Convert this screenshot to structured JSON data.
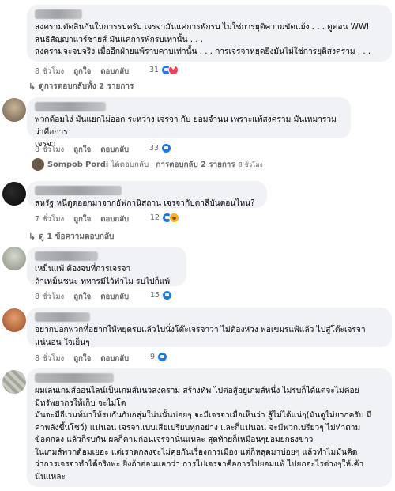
{
  "colors": {
    "bubble": "#f0f2f5",
    "meta_text": "#65676b",
    "like": "#1877f2",
    "love": "#f33e58",
    "haha": "#f7b125"
  },
  "actions": {
    "like": "ถูกใจ",
    "reply": "ตอบกลับ"
  },
  "comments": [
    {
      "text": "สงครามตัดสินกันในการรบครับ เจรจามันแค่การพักรบ ไม่ใช่การยุติความขัดแย้ง . . . ดูตอน WWI\nสนธิสัญญาแวร์ซายส์ มันแค่การพักรบเท่านั้น . . .\nสงครามจะจบจริง เมื่ออีกฝ่ายแพ้ราบคาบเท่านั้น . . . การเจรจาหยุดยิงมันไม่ใช่การยุติสงคราม . . .",
      "time": "8 ชั่วโมง",
      "reactions": "31",
      "reaction_icons": [
        "like-icon",
        "love-icon"
      ],
      "replies_link": "ดูการตอบกลับทั้ง 2 รายการ"
    },
    {
      "text": "พวกด้อมโง่ มันแยกไม่ออก ระหว่าง เจรจา กับ ยอมจำนน เพราะแพ้สงคราม มันเหมารวมว่าคือการ\nเจรจา",
      "time": "8 ชั่วโมง",
      "reactions": "33",
      "reaction_icons": [
        "like-icon"
      ],
      "reply_preview": {
        "name": "Sompob Pordi",
        "action": "ได้ตอบกลับ ·",
        "count": "การตอบกลับ 2 รายการ",
        "time": "8 ชั่วโมง"
      }
    },
    {
      "text": "สหรัฐ หนีตูดออกมาจากอัฟกานิสถาน เจรจากับตาลีบันตอนไหน?",
      "time": "7 ชั่วโมง",
      "reactions": "12",
      "reaction_icons": [
        "like-icon",
        "haha-icon"
      ],
      "replies_link": "ดู 1 ข้อความตอบกลับ"
    },
    {
      "text": "เหม็นแพ้ ต้องจบที่การเจรจา\nถ้าเหม็นชนะ ทหารมีไว้ทำไม รบไปก็แพ้",
      "time": "8 ชั่วโมง",
      "reactions": "15",
      "reaction_icons": [
        "like-icon"
      ]
    },
    {
      "text": "อยากบอกพวกที่อยากให้หยุดรบแล้วไปนั่งโต๊ะเจรจาว่า ไม่ต้องห่วง พอเขมรแพ้แล้ว ไปสู่โต๊ะเจรจา\nแน่นอน ใจเย็นๆ",
      "time": "8 ชั่วโมง",
      "reactions": "9",
      "reaction_icons": [
        "like-icon"
      ]
    },
    {
      "text": "ผมเล่นเกมส์ออนไลน์เป็นเกมส์แนวสงคราม สร้างทัพ ไปต่อสู้อยู่เกมส์หนึ่ง ไม่รบก็ได้แต่จะไม่ค่อย\nมีทรัพยากรให้เก็บ จะไม่โต\nมันจะมีอีเวนท์มาให้รบกันกับกลุ่มใน่นนั้นบ่อยๆ จะมีเจรจาเมื่อเห็นว่า สู้ไม่ได้แน่ๆ(มันดูไม่ยากครับ มี\nค่าพลังขึ้นโชว์) แน่นอน เจรจาแบบเสียเปรียบทุกอย่าง และก็แน่นอน จะมีพวกเปรียวๆ ไม่ทำตาม\nข้อตกลง แล้วก็รบกัน ผลก็คามก่อนเจรจานั่นแหละ สุดท้ายก็เหมือนๆยอมยกธงขาว\nในเกมส์พวกด้อมเยอะ แต่เราตกลงจะไม่คุยกันเรื่องการเมือง แต่ก็หลุดมาบ่อยๆ แล้วทำไมมันคิด\nว่าการเจรจาทำได้จริงพ่ะ ยิ่งถ้าอ่อนแอกว่า การไปเจรจาคือการไปยอมแพ้ ไปยกอะไรต่างๆให้เค้า\nนั่นแหละ",
      "time": "",
      "reactions": "",
      "reaction_icons": []
    }
  ]
}
